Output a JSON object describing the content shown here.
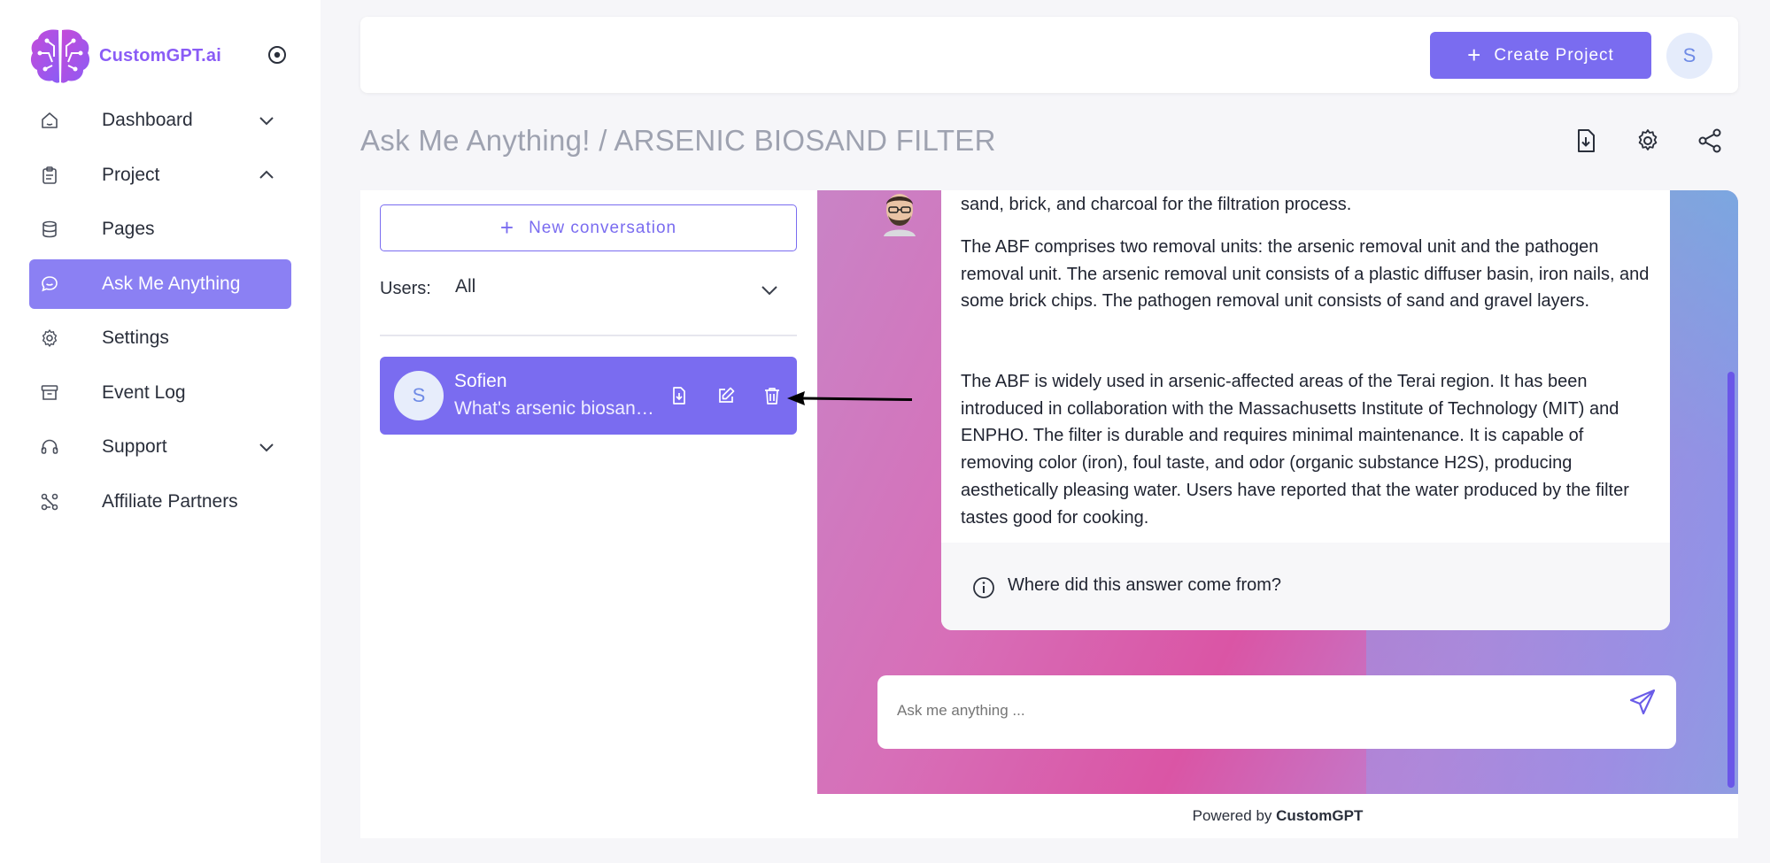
{
  "brand": {
    "name": "CustomGPT.ai"
  },
  "sidebar": {
    "items": [
      {
        "label": "Dashboard",
        "icon": "home-icon",
        "chevron": "down"
      },
      {
        "label": "Project",
        "icon": "clipboard-icon",
        "chevron": "up"
      },
      {
        "label": "Pages",
        "icon": "database-icon",
        "chevron": ""
      },
      {
        "label": "Ask Me Anything",
        "icon": "chat-icon",
        "chevron": "",
        "active": true
      },
      {
        "label": "Settings",
        "icon": "gear-icon",
        "chevron": ""
      },
      {
        "label": "Event Log",
        "icon": "archive-icon",
        "chevron": ""
      },
      {
        "label": "Support",
        "icon": "headset-icon",
        "chevron": "down"
      },
      {
        "label": "Affiliate Partners",
        "icon": "network-icon",
        "chevron": ""
      }
    ]
  },
  "topbar": {
    "create_label": "Create Project",
    "avatar_initial": "S"
  },
  "page": {
    "title": "Ask Me Anything! / ARSENIC BIOSAND FILTER"
  },
  "conversations": {
    "new_label": "New conversation",
    "users_label": "Users:",
    "users_value": "All",
    "items": [
      {
        "initial": "S",
        "name": "Sofien",
        "preview": "What's arsenic biosand filter?"
      }
    ]
  },
  "chat": {
    "paragraphs": [
      "sand, brick, and charcoal for the filtration process.",
      "The ABF comprises two removal units: the arsenic removal unit and the pathogen removal unit. The arsenic removal unit consists of a plastic diffuser basin, iron nails, and some brick chips. The pathogen removal unit consists of sand and gravel layers.",
      "The ABF is widely used in arsenic-affected areas of the Terai region. It has been introduced in collaboration with the Massachusetts Institute of Technology (MIT) and ENPHO. The filter is durable and requires minimal maintenance. It is capable of removing color (iron), foul taste, and odor (organic substance H2S), producing aesthetically pleasing water. Users have reported that the water produced by the filter tastes good for cooking."
    ],
    "source_label": "Where did this answer come from?",
    "input_placeholder": "Ask me anything ...",
    "powered_prefix": "Powered by",
    "powered_brand": "CustomGPT"
  },
  "colors": {
    "accent": "#7a6cf0",
    "active_nav": "#8b80f3",
    "brand_text": "#8a5cf6"
  }
}
